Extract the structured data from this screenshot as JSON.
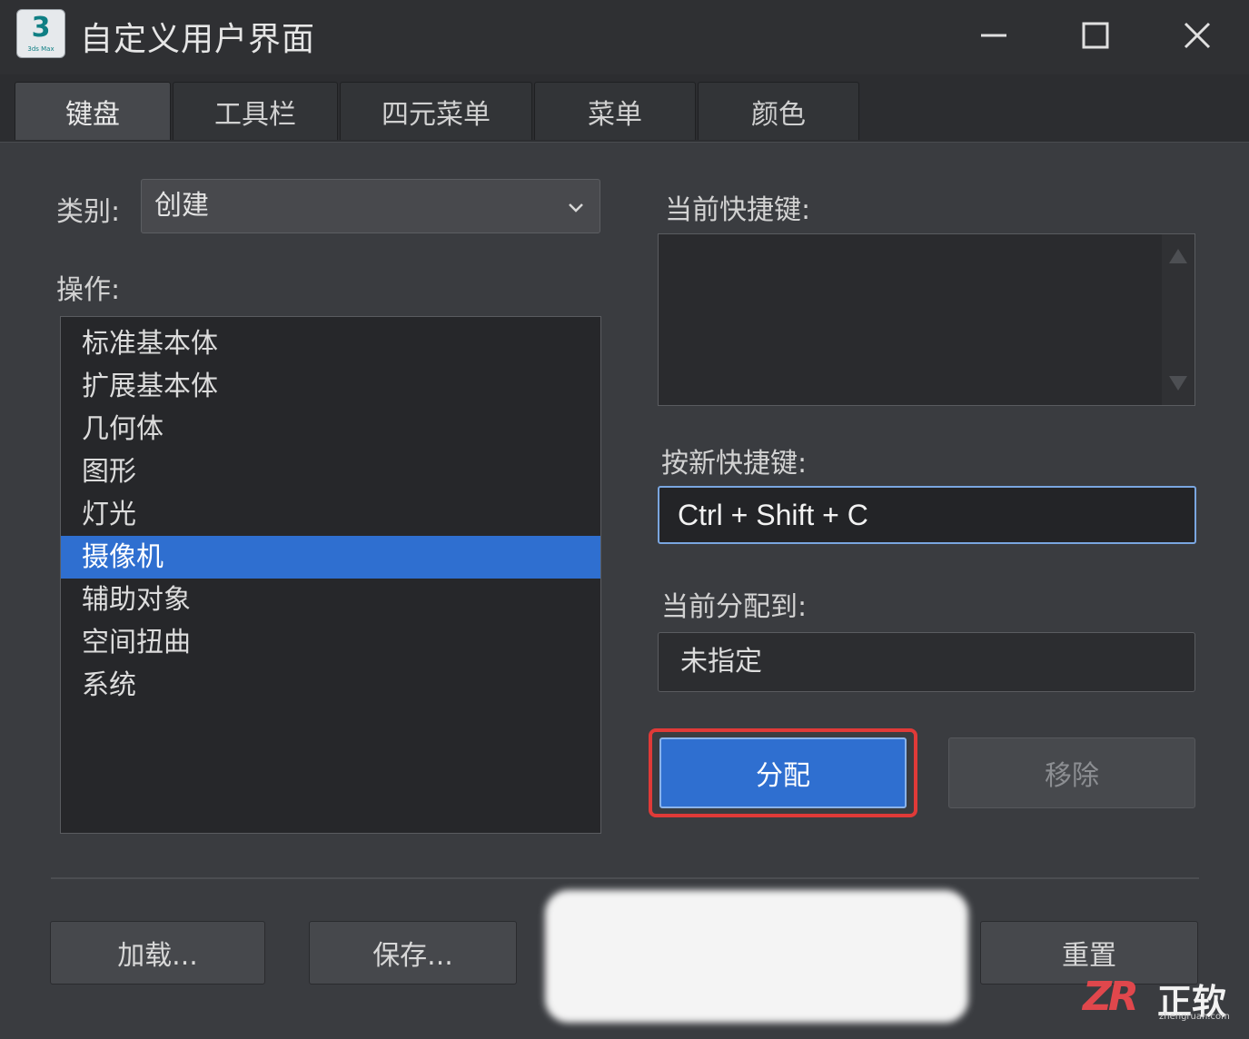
{
  "window": {
    "title": "自定义用户界面",
    "app_icon": {
      "number": "3",
      "caption": "3ds Max"
    }
  },
  "tabs": [
    {
      "label": "键盘",
      "active": true
    },
    {
      "label": "工具栏",
      "active": false
    },
    {
      "label": "四元菜单",
      "active": false
    },
    {
      "label": "菜单",
      "active": false
    },
    {
      "label": "颜色",
      "active": false
    }
  ],
  "left": {
    "category_label": "类别:",
    "category_value": "创建",
    "actions_label": "操作:",
    "actions": [
      "标准基本体",
      "扩展基本体",
      "几何体",
      "图形",
      "灯光",
      "摄像机",
      "辅助对象",
      "空间扭曲",
      "系统"
    ],
    "selected_action": "摄像机"
  },
  "right": {
    "current_shortcut_label": "当前快捷键:",
    "new_shortcut_label": "按新快捷键:",
    "new_shortcut_value": "Ctrl + Shift + C",
    "assigned_to_label": "当前分配到:",
    "assigned_to_value": "未指定",
    "assign_button": "分配",
    "remove_button": "移除"
  },
  "bottom": {
    "load_button": "加载...",
    "save_button": "保存...",
    "reset_button": "重置"
  },
  "watermark": {
    "logo": "ZR",
    "text": "正软",
    "url": "zhengruan.com"
  },
  "colors": {
    "accent": "#2f6fd0",
    "highlight_border": "#e03a38",
    "background": "#3a3c40"
  }
}
